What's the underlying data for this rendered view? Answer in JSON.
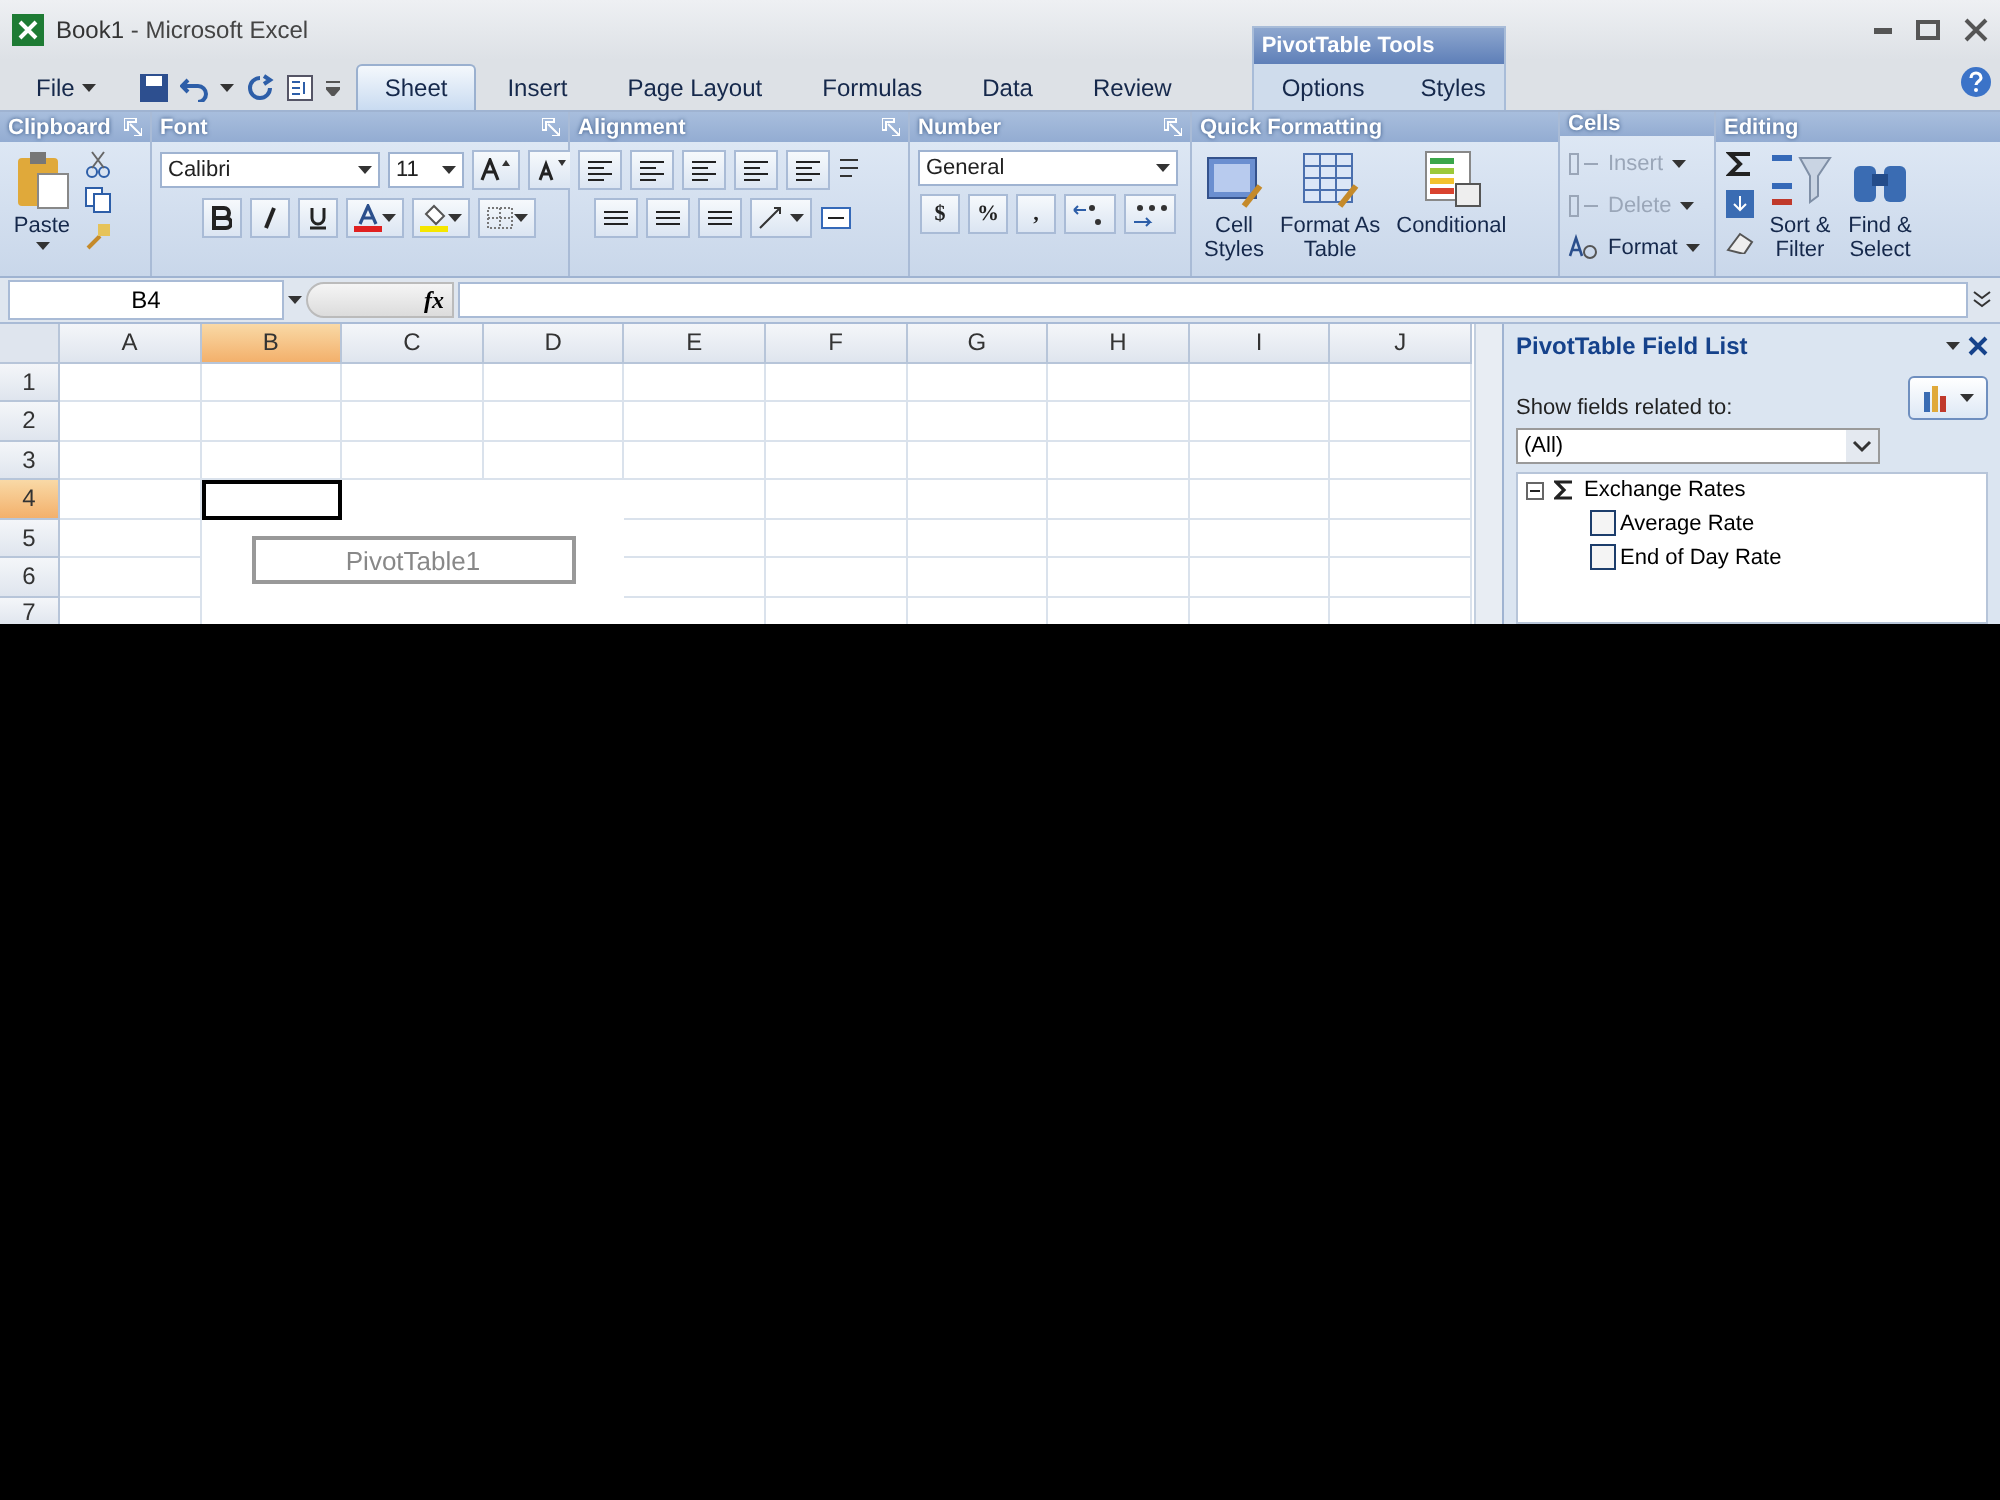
{
  "window": {
    "title": "Book1",
    "app": "- Microsoft Excel"
  },
  "tabs": [
    {
      "label": "File",
      "kind": "menu",
      "selected": false
    },
    {
      "label": "Sheet",
      "kind": "tab",
      "selected": true
    },
    {
      "label": "Insert",
      "kind": "tab",
      "selected": false
    },
    {
      "label": "Page Layout",
      "kind": "tab",
      "selected": false
    },
    {
      "label": "Formulas",
      "kind": "tab",
      "selected": false
    },
    {
      "label": "Data",
      "kind": "tab",
      "selected": false
    },
    {
      "label": "Review",
      "kind": "tab",
      "selected": false
    }
  ],
  "contextual": {
    "title": "PivotTable Tools",
    "tabs": [
      {
        "label": "Options",
        "selected": false
      },
      {
        "label": "Styles",
        "selected": false
      }
    ]
  },
  "ribbon": {
    "clipboard": {
      "title": "Clipboard",
      "paste": "Paste"
    },
    "font": {
      "title": "Font",
      "name": "Calibri",
      "size": "11"
    },
    "alignment": {
      "title": "Alignment"
    },
    "number": {
      "title": "Number",
      "format": "General",
      "buttons": [
        "$",
        "%",
        ","
      ]
    },
    "quick_formatting": {
      "title": "Quick Formatting",
      "buttons": [
        {
          "kind": "styles",
          "lines": [
            "Cell",
            "Styles"
          ]
        },
        {
          "kind": "table",
          "lines": [
            "Format As",
            "Table"
          ]
        },
        {
          "kind": "conditional",
          "lines": [
            "Conditional"
          ]
        }
      ]
    },
    "cells": {
      "title": "Cells",
      "buttons": [
        {
          "kind": "insert",
          "label": "Insert",
          "disabled": true
        },
        {
          "kind": "delete",
          "label": "Delete",
          "disabled": true
        },
        {
          "kind": "format",
          "label": "Format",
          "disabled": false
        }
      ]
    },
    "editing": {
      "title": "Editing",
      "buttons": [
        {
          "kind": "sort",
          "lines": [
            "Sort &",
            "Filter"
          ]
        },
        {
          "kind": "find",
          "lines": [
            "Find &",
            "Select"
          ]
        }
      ]
    }
  },
  "formula_bar": {
    "name_box": "B4",
    "fx": "fx"
  },
  "sheet": {
    "columns": [
      {
        "label": "A",
        "selected": false
      },
      {
        "label": "B",
        "selected": true
      },
      {
        "label": "C",
        "selected": false
      },
      {
        "label": "D",
        "selected": false
      },
      {
        "label": "E",
        "selected": false
      },
      {
        "label": "F",
        "selected": false
      },
      {
        "label": "G",
        "selected": false
      },
      {
        "label": "H",
        "selected": false
      },
      {
        "label": "I",
        "selected": false
      },
      {
        "label": "J",
        "selected": false
      }
    ],
    "rows": [
      {
        "label": "1",
        "selected": false
      },
      {
        "label": "2",
        "selected": false
      },
      {
        "label": "3",
        "selected": false
      },
      {
        "label": "4",
        "selected": true
      },
      {
        "label": "5",
        "selected": false
      },
      {
        "label": "6",
        "selected": false
      },
      {
        "label": "7",
        "selected": false
      }
    ],
    "pivot_placeholder": "PivotTable1"
  },
  "field_list": {
    "title": "PivotTable Field List",
    "show_label": "Show fields related to:",
    "filter": "(All)",
    "tree": [
      {
        "label": "Exchange Rates",
        "expanded": true,
        "children": [
          {
            "label": "Average Rate",
            "checked": false
          },
          {
            "label": "End of Day Rate",
            "checked": false
          }
        ]
      }
    ]
  }
}
